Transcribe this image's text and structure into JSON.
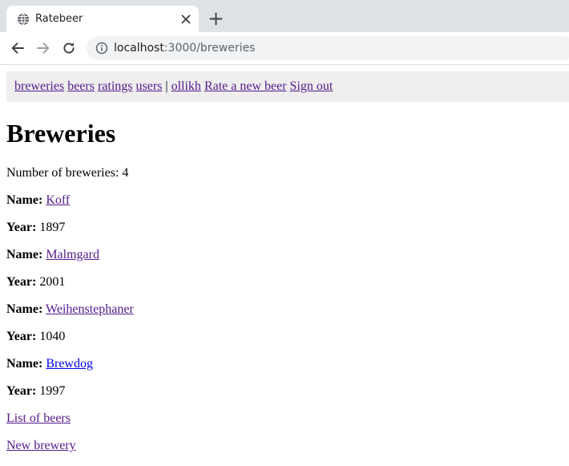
{
  "browser": {
    "tab_title": "Ratebeer",
    "url_host": "localhost",
    "url_path": ":3000/breweries"
  },
  "nav": {
    "breweries": "breweries",
    "beers": "beers",
    "ratings": "ratings",
    "users": "users",
    "separator": "|",
    "username": "ollikh",
    "rate_new_beer": "Rate a new beer",
    "sign_out": "Sign out"
  },
  "page": {
    "title": "Breweries",
    "count_label": "Number of breweries:",
    "count_value": "4",
    "name_label": "Name:",
    "year_label": "Year:"
  },
  "breweries": [
    {
      "name": "Koff",
      "year": "1897",
      "visited": true
    },
    {
      "name": "Malmgard",
      "year": "2001",
      "visited": true
    },
    {
      "name": "Weihenstephaner",
      "year": "1040",
      "visited": true
    },
    {
      "name": "Brewdog",
      "year": "1997",
      "visited": false
    }
  ],
  "footer_links": {
    "list_of_beers": "List of beers",
    "new_brewery": "New brewery"
  },
  "icons": {
    "favicon": "globe-icon",
    "tab_close": "close-icon",
    "new_tab": "plus-icon",
    "back": "arrow-left-icon",
    "forward": "arrow-right-icon",
    "reload": "reload-icon",
    "site_info": "info-icon"
  },
  "colors": {
    "visited_link": "#551a8b",
    "unvisited_link": "#0000ee",
    "navbar_bg": "#eeeeee",
    "tabstrip_bg": "#dee1e6",
    "omnibox_bg": "#f1f3f4"
  }
}
